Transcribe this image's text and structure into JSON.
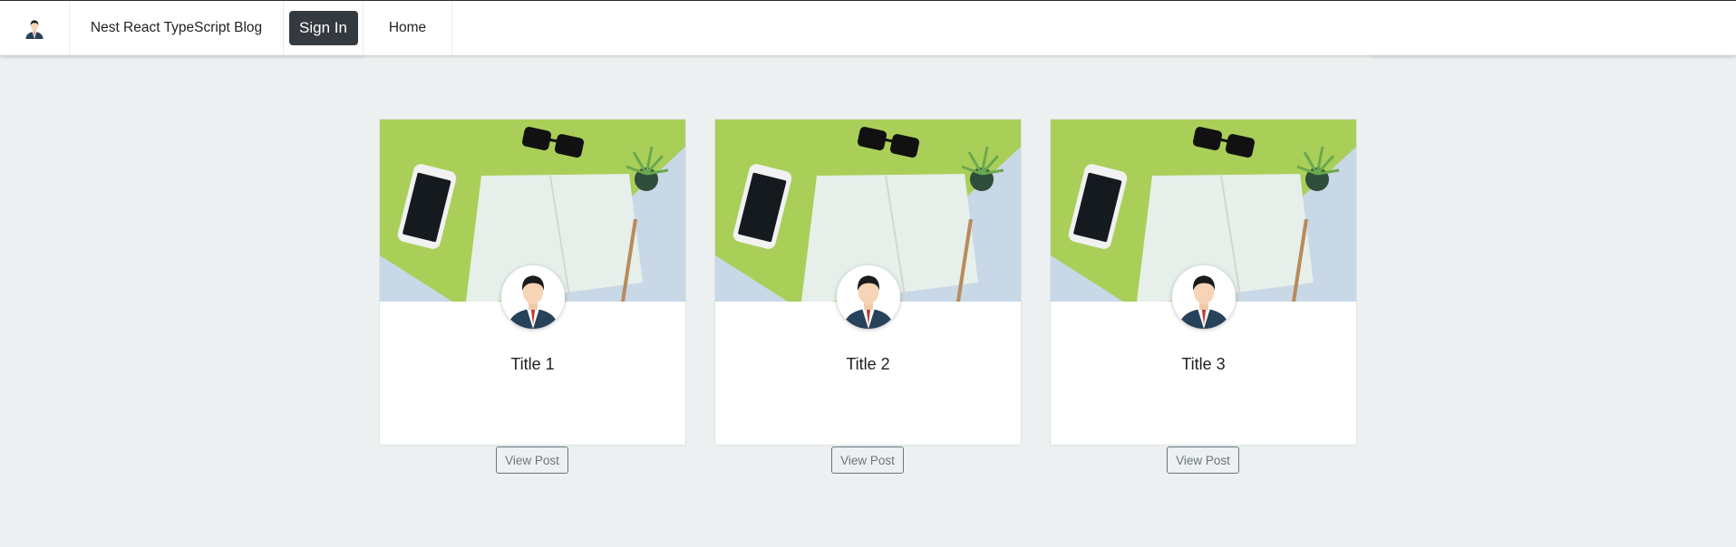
{
  "navbar": {
    "brand": "Nest React TypeScript Blog",
    "sign_in_label": "Sign In",
    "home_label": "Home",
    "logo_icon": "user-avatar-icon"
  },
  "posts": [
    {
      "title": "Title 1",
      "view_label": "View Post"
    },
    {
      "title": "Title 2",
      "view_label": "View Post"
    },
    {
      "title": "Title 3",
      "view_label": "View Post"
    }
  ],
  "colors": {
    "page_bg": "#ecf0f1",
    "navbar_bg": "#ffffff",
    "sign_in_bg": "#343a40",
    "view_button_border": "#6c757d",
    "image_green": "#a9cf59",
    "image_blue": "#c8d8e6"
  }
}
